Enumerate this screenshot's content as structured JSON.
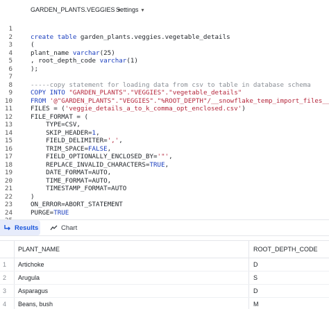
{
  "topbar": {
    "database": "GARDEN_PLANTS.VEGGIES",
    "settings": "Settings"
  },
  "editor": {
    "lines": [
      {
        "n": "1",
        "segs": []
      },
      {
        "n": "2",
        "segs": [
          {
            "t": "kw",
            "v": "create table"
          },
          {
            "t": "",
            "v": " garden_plants.veggies.vegetable_details"
          }
        ]
      },
      {
        "n": "3",
        "segs": [
          {
            "t": "",
            "v": "("
          }
        ]
      },
      {
        "n": "4",
        "segs": [
          {
            "t": "",
            "v": "plant_name "
          },
          {
            "t": "kw",
            "v": "varchar"
          },
          {
            "t": "",
            "v": "(25)"
          }
        ]
      },
      {
        "n": "5",
        "segs": [
          {
            "t": "",
            "v": ", root_depth_code "
          },
          {
            "t": "kw",
            "v": "varchar"
          },
          {
            "t": "",
            "v": "(1)"
          }
        ]
      },
      {
        "n": "6",
        "segs": [
          {
            "t": "",
            "v": ");"
          }
        ]
      },
      {
        "n": "7",
        "segs": []
      },
      {
        "n": "8",
        "segs": [
          {
            "t": "cm",
            "v": "-----copy statement for loading data from csv to table in database schema"
          }
        ]
      },
      {
        "n": "9",
        "segs": [
          {
            "t": "kw",
            "v": "COPY INTO"
          },
          {
            "t": "",
            "v": " "
          },
          {
            "t": "str",
            "v": "\"GARDEN_PLANTS\".\"VEGGIES\".\"vegetable_details\""
          }
        ]
      },
      {
        "n": "10",
        "segs": [
          {
            "t": "kw",
            "v": "FROM"
          },
          {
            "t": "",
            "v": " "
          },
          {
            "t": "str",
            "v": "'@\"GARDEN_PLANTS\".\"VEGGIES\".\"%ROOT_DEPTH\"/__snowflake_temp_import_files__/'"
          }
        ]
      },
      {
        "n": "11",
        "segs": [
          {
            "t": "",
            "v": "FILES = ("
          },
          {
            "t": "str",
            "v": "'veggie_details_a_to_k_comma_opt_enclosed.csv'"
          },
          {
            "t": "",
            "v": ")"
          }
        ]
      },
      {
        "n": "12",
        "segs": [
          {
            "t": "",
            "v": "FILE_FORMAT = ("
          }
        ]
      },
      {
        "n": "13",
        "segs": [
          {
            "t": "",
            "v": "    TYPE=CSV,"
          }
        ]
      },
      {
        "n": "14",
        "segs": [
          {
            "t": "",
            "v": "    SKIP_HEADER="
          },
          {
            "t": "bl",
            "v": "1"
          },
          {
            "t": "",
            "v": ","
          }
        ]
      },
      {
        "n": "15",
        "segs": [
          {
            "t": "",
            "v": "    FIELD_DELIMITER="
          },
          {
            "t": "str",
            "v": "','"
          },
          {
            "t": "",
            "v": ","
          }
        ]
      },
      {
        "n": "16",
        "segs": [
          {
            "t": "",
            "v": "    TRIM_SPACE="
          },
          {
            "t": "bl",
            "v": "FALSE"
          },
          {
            "t": "",
            "v": ","
          }
        ]
      },
      {
        "n": "17",
        "segs": [
          {
            "t": "",
            "v": "    FIELD_OPTIONALLY_ENCLOSED_BY="
          },
          {
            "t": "str",
            "v": "'\"'"
          },
          {
            "t": "",
            "v": ","
          }
        ]
      },
      {
        "n": "18",
        "segs": [
          {
            "t": "",
            "v": "    REPLACE_INVALID_CHARACTERS="
          },
          {
            "t": "bl",
            "v": "TRUE"
          },
          {
            "t": "",
            "v": ","
          }
        ]
      },
      {
        "n": "19",
        "segs": [
          {
            "t": "",
            "v": "    DATE_FORMAT=AUTO,"
          }
        ]
      },
      {
        "n": "20",
        "segs": [
          {
            "t": "",
            "v": "    TIME_FORMAT=AUTO,"
          }
        ]
      },
      {
        "n": "21",
        "segs": [
          {
            "t": "",
            "v": "    TIMESTAMP_FORMAT=AUTO"
          }
        ]
      },
      {
        "n": "22",
        "segs": [
          {
            "t": "",
            "v": ")"
          }
        ]
      },
      {
        "n": "23",
        "segs": [
          {
            "t": "",
            "v": "ON_ERROR=ABORT_STATEMENT"
          }
        ]
      },
      {
        "n": "24",
        "segs": [
          {
            "t": "",
            "v": "PURGE="
          },
          {
            "t": "bl",
            "v": "TRUE"
          }
        ]
      },
      {
        "n": "25",
        "segs": []
      }
    ]
  },
  "tabs": {
    "results": "Results",
    "chart": "Chart"
  },
  "table": {
    "columns": [
      "PLANT_NAME",
      "ROOT_DEPTH_CODE"
    ],
    "rows": [
      {
        "idx": "1",
        "plant_name": "Artichoke",
        "root_depth_code": "D"
      },
      {
        "idx": "2",
        "plant_name": "Arugula",
        "root_depth_code": "S"
      },
      {
        "idx": "3",
        "plant_name": "Asparagus",
        "root_depth_code": "D"
      },
      {
        "idx": "4",
        "plant_name": "Beans, bush",
        "root_depth_code": "M"
      }
    ]
  },
  "colors": {
    "keyword": "#1b3fbf",
    "string": "#b5273c",
    "comment": "#8a8f96",
    "active_tab": "#1a56db"
  }
}
